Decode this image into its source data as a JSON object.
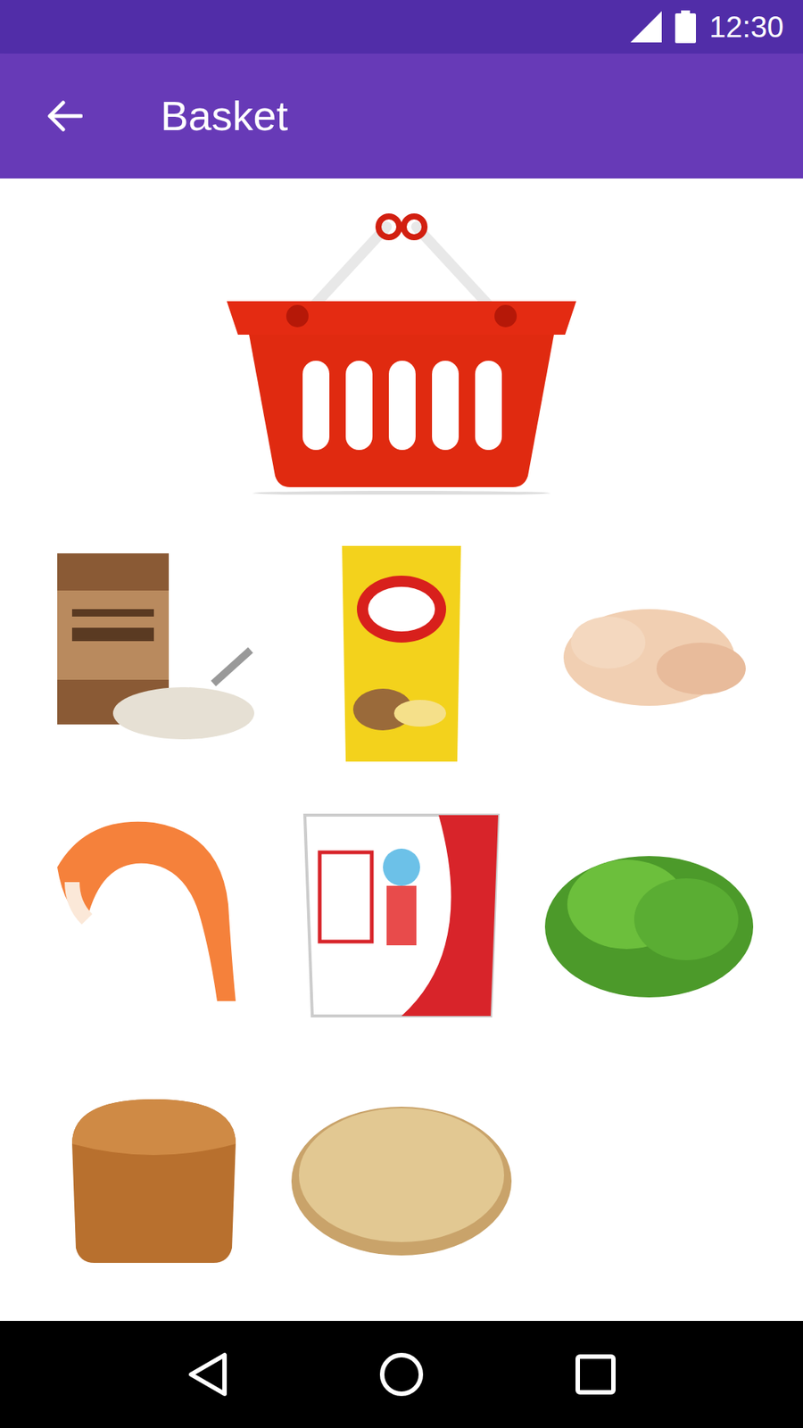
{
  "status_bar": {
    "time": "12:30"
  },
  "app_bar": {
    "title": "Basket"
  },
  "items": [
    {
      "kind": "flour"
    },
    {
      "kind": "chips"
    },
    {
      "kind": "chicken"
    },
    {
      "kind": "shrimp"
    },
    {
      "kind": "milk"
    },
    {
      "kind": "lettuce"
    },
    {
      "kind": "bread"
    },
    {
      "kind": "flatbread"
    }
  ]
}
